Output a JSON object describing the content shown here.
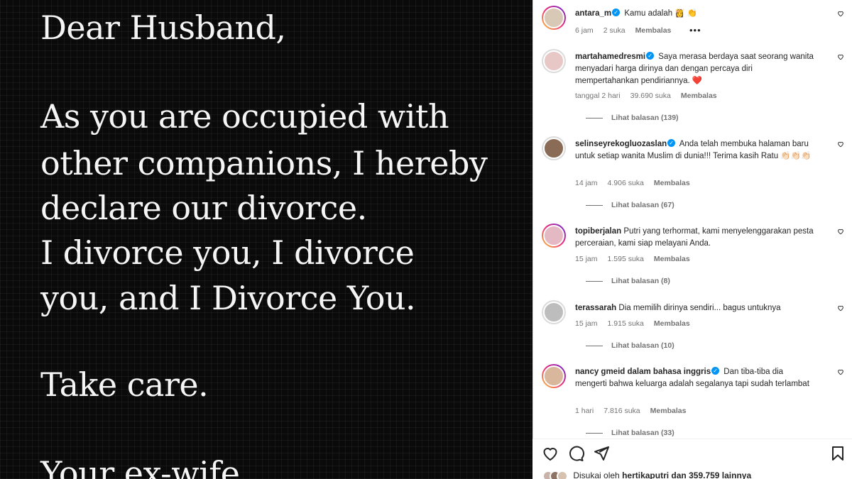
{
  "post": {
    "letter_lines": [
      "Dear Husband,",
      "As you are occupied with",
      "other companions, I hereby",
      "declare our divorce.",
      "I divorce you, I divorce",
      "you, and I Divorce You.",
      "Take care.",
      "Your ex-wife"
    ]
  },
  "comments": [
    {
      "username": "antara_m",
      "verified": true,
      "text": "Kamu adalah 👸 👏",
      "time": "6 jam",
      "likes": "2 suka",
      "reply": "Membalas",
      "more": "•••",
      "replies": "",
      "avatar_style": "ring"
    },
    {
      "username": "martahamedresmi",
      "verified": true,
      "text": "Saya merasa berdaya saat seorang wanita menyadari harga dirinya dan dengan percaya diri mempertahankan pendiriannya. ❤️",
      "time": "tanggal 2 hari",
      "likes": "39.690 suka",
      "reply": "Membalas",
      "replies": "Lihat balasan (139)",
      "avatar_style": "plain"
    },
    {
      "username": "selinseyrekogluozaslan",
      "verified": true,
      "text": "Anda telah membuka halaman baru untuk setiap wanita Muslim di dunia!!! Terima kasih Ratu 👏🏻👏🏻👏🏻",
      "time": "14 jam",
      "likes": "4.906 suka",
      "reply": "Membalas",
      "replies": "Lihat balasan (67)",
      "avatar_style": "plain"
    },
    {
      "username": "topiberjalan",
      "verified": false,
      "text": "Putri yang terhormat, kami menyelenggarakan pesta perceraian, kami siap melayani Anda.",
      "time": "15 jam",
      "likes": "1.595 suka",
      "reply": "Membalas",
      "replies": "Lihat balasan (8)",
      "avatar_style": "ring"
    },
    {
      "username": "terassarah",
      "verified": false,
      "text": "Dia memilih dirinya sendiri... bagus untuknya",
      "time": "15 jam",
      "likes": "1.915 suka",
      "reply": "Membalas",
      "replies": "Lihat balasan (10)",
      "avatar_style": "plain"
    },
    {
      "username": "nancy gmeid dalam bahasa inggris",
      "verified": true,
      "text": "Dan tiba-tiba dia mengerti bahwa keluarga adalah segalanya tapi sudah terlambat",
      "time": "1 hari",
      "likes": "7.816 suka",
      "reply": "Membalas",
      "replies": "Lihat balasan (33)",
      "avatar_style": "ring"
    }
  ],
  "likes_line": {
    "prefix": "Disukai oleh",
    "user": "hertikaputri",
    "suffix": "dan 359.759 lainnya"
  },
  "icons": [
    "heart-icon",
    "comment-icon",
    "share-icon",
    "bookmark-icon"
  ]
}
